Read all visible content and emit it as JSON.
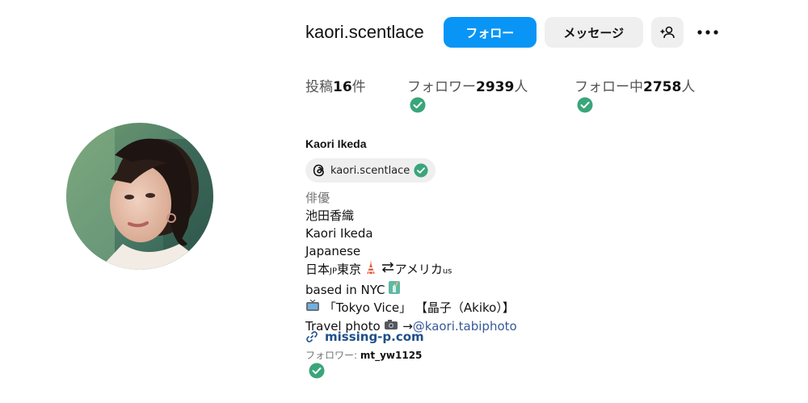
{
  "profile": {
    "username": "kaori.scentlace",
    "display_name": "Kaori Ikeda"
  },
  "actions": {
    "follow_label": "フォロー",
    "message_label": "メッセージ",
    "suggest_icon": "person-add-icon",
    "more_icon": "more-horizontal-icon"
  },
  "stats": {
    "posts_prefix": "投稿",
    "posts_count": "16",
    "posts_suffix": "件",
    "followers_prefix": "フォロワー",
    "followers_count": "2939",
    "followers_suffix": "人",
    "following_prefix": "フォロー中",
    "following_count": "2758",
    "following_suffix": "人"
  },
  "threads": {
    "handle": "kaori.scentlace",
    "icon": "threads-icon"
  },
  "bio": {
    "category": "俳優",
    "line1": "池田香織",
    "line2": "Kaori Ikeda",
    "line3": "Japanese",
    "line4_a": "日本",
    "line4_jp": "JP",
    "line4_b": "東京",
    "line4_c": "アメリカ",
    "line4_us": "us",
    "line5": "based in NYC",
    "line6": "「Tokyo Vice」 【晶子（Akiko）】",
    "line7_a": "Travel photo",
    "line7_b": "→",
    "line7_mention": "@kaori.tabiphoto"
  },
  "link": {
    "text": "missing-p.com",
    "icon": "link-icon"
  },
  "followed_by": {
    "prefix": "フォロワー: ",
    "user": "mt_yw1125"
  },
  "colors": {
    "primary_button": "#0895f6",
    "secondary_button": "#efefef",
    "verified_green": "#3aa57a",
    "link_blue": "#1e4f8a",
    "mention_blue": "#385898"
  }
}
